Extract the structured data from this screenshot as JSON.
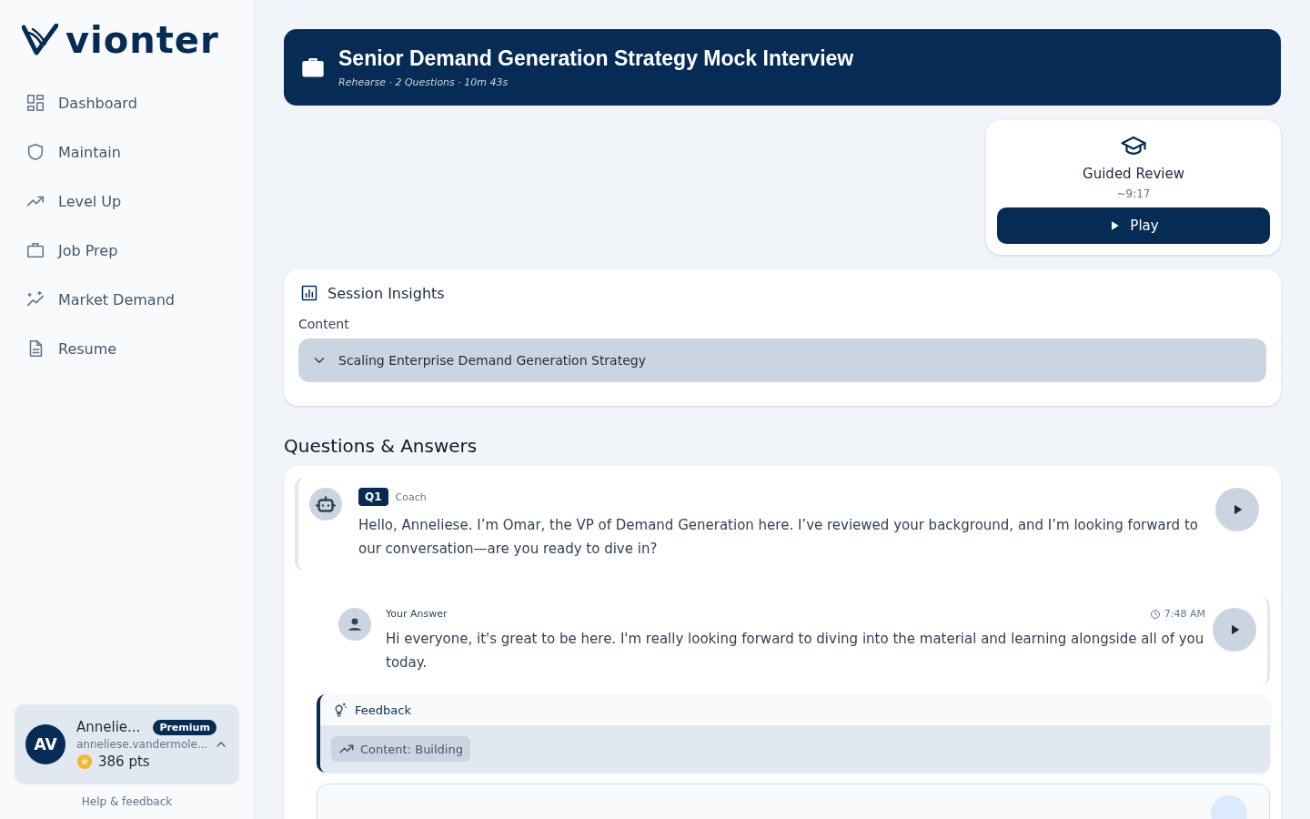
{
  "sidebar": {
    "logo": "vionter",
    "items": [
      {
        "label": "Dashboard",
        "selected": false
      },
      {
        "label": "Maintain",
        "selected": false
      },
      {
        "label": "Level Up",
        "selected": false
      },
      {
        "label": "Job Prep",
        "selected": false
      },
      {
        "label": "Market Demand",
        "selected": false
      },
      {
        "label": "Resume",
        "selected": false
      }
    ],
    "user": {
      "initials": "AV",
      "name": "Annelie...",
      "badge": "Premium",
      "email": "anneliese.vandermole...",
      "points": "386 pts",
      "expanded": true
    },
    "help": "Help & feedback"
  },
  "header": {
    "title": "Senior Demand Generation Strategy Mock Interview",
    "subtitle": "Rehearse · 2 Questions · 10m 43s"
  },
  "guided_review": {
    "title": "Guided Review",
    "duration": "~9:17",
    "button": "Play"
  },
  "insights": {
    "title": "Session Insights",
    "section": "Content",
    "topics": [
      {
        "label": "Scaling Enterprise Demand Generation Strategy",
        "expanded": false
      }
    ]
  },
  "qa": {
    "heading": "Questions & Answers",
    "question": {
      "badge": "Q1",
      "role": "Coach",
      "text": "Hello, Anneliese. I’m Omar, the VP of Demand Generation here. I’ve reviewed your background, and I’m looking forward to our conversation—are you ready to dive in?"
    },
    "answer": {
      "label": "Your Answer",
      "time": "7:48 AM",
      "text": "Hi everyone, it's great to be here. I'm really looking forward to diving into the material and learning alongside all of you today."
    },
    "feedback": {
      "title": "Feedback",
      "tags": [
        "Content: Building"
      ]
    }
  }
}
